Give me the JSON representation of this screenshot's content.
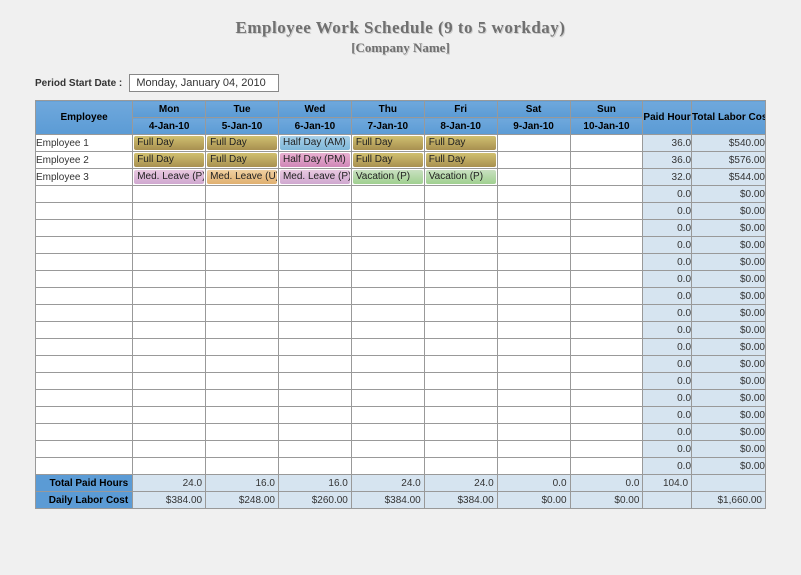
{
  "title": "Employee Work Schedule (9 to 5  workday)",
  "subtitle": "[Company Name]",
  "period_label": "Period Start Date :",
  "period_value": "Monday, January 04, 2010",
  "headers": {
    "employee": "Employee",
    "paid_hours": "Paid Hours",
    "total_cost": "Total Labor Cost",
    "days": [
      {
        "dow": "Mon",
        "date": "4-Jan-10"
      },
      {
        "dow": "Tue",
        "date": "5-Jan-10"
      },
      {
        "dow": "Wed",
        "date": "6-Jan-10"
      },
      {
        "dow": "Thu",
        "date": "7-Jan-10"
      },
      {
        "dow": "Fri",
        "date": "8-Jan-10"
      },
      {
        "dow": "Sat",
        "date": "9-Jan-10"
      },
      {
        "dow": "Sun",
        "date": "10-Jan-10"
      }
    ]
  },
  "rows": [
    {
      "name": "Employee 1",
      "cells": [
        {
          "t": "Full Day",
          "c": "full-day"
        },
        {
          "t": "Full Day",
          "c": "full-day"
        },
        {
          "t": "Half Day (AM)",
          "c": "half-am"
        },
        {
          "t": "Full Day",
          "c": "full-day"
        },
        {
          "t": "Full Day",
          "c": "full-day"
        },
        null,
        null
      ],
      "hours": "36.0",
      "cost": "$540.00"
    },
    {
      "name": "Employee 2",
      "cells": [
        {
          "t": "Full Day",
          "c": "full-day"
        },
        {
          "t": "Full Day",
          "c": "full-day",
          "dd": true
        },
        {
          "t": "Half Day (PM)",
          "c": "half-pm"
        },
        {
          "t": "Full Day",
          "c": "full-day"
        },
        {
          "t": "Full Day",
          "c": "full-day"
        },
        null,
        null
      ],
      "hours": "36.0",
      "cost": "$576.00"
    },
    {
      "name": "Employee 3",
      "cells": [
        {
          "t": "Med. Leave (P)",
          "c": "med-p"
        },
        {
          "t": "Med. Leave (U)",
          "c": "med-u"
        },
        {
          "t": "Med. Leave (P)",
          "c": "med-p"
        },
        {
          "t": "Vacation (P)",
          "c": "vac-p"
        },
        {
          "t": "Vacation (P)",
          "c": "vac-p"
        },
        null,
        null
      ],
      "hours": "32.0",
      "cost": "$544.00"
    },
    {
      "name": "",
      "cells": [
        null,
        null,
        null,
        null,
        null,
        null,
        null
      ],
      "hours": "0.0",
      "cost": "$0.00"
    },
    {
      "name": "",
      "cells": [
        null,
        null,
        null,
        null,
        null,
        null,
        null
      ],
      "hours": "0.0",
      "cost": "$0.00"
    },
    {
      "name": "",
      "cells": [
        null,
        null,
        null,
        null,
        null,
        null,
        null
      ],
      "hours": "0.0",
      "cost": "$0.00"
    },
    {
      "name": "",
      "cells": [
        null,
        null,
        null,
        null,
        null,
        null,
        null
      ],
      "hours": "0.0",
      "cost": "$0.00"
    },
    {
      "name": "",
      "cells": [
        null,
        null,
        null,
        null,
        null,
        null,
        null
      ],
      "hours": "0.0",
      "cost": "$0.00"
    },
    {
      "name": "",
      "cells": [
        null,
        null,
        null,
        null,
        null,
        null,
        null
      ],
      "hours": "0.0",
      "cost": "$0.00"
    },
    {
      "name": "",
      "cells": [
        null,
        null,
        null,
        null,
        null,
        null,
        null
      ],
      "hours": "0.0",
      "cost": "$0.00"
    },
    {
      "name": "",
      "cells": [
        null,
        null,
        null,
        null,
        null,
        null,
        null
      ],
      "hours": "0.0",
      "cost": "$0.00"
    },
    {
      "name": "",
      "cells": [
        null,
        null,
        null,
        null,
        null,
        null,
        null
      ],
      "hours": "0.0",
      "cost": "$0.00"
    },
    {
      "name": "",
      "cells": [
        null,
        null,
        null,
        null,
        null,
        null,
        null
      ],
      "hours": "0.0",
      "cost": "$0.00"
    },
    {
      "name": "",
      "cells": [
        null,
        null,
        null,
        null,
        null,
        null,
        null
      ],
      "hours": "0.0",
      "cost": "$0.00"
    },
    {
      "name": "",
      "cells": [
        null,
        null,
        null,
        null,
        null,
        null,
        null
      ],
      "hours": "0.0",
      "cost": "$0.00"
    },
    {
      "name": "",
      "cells": [
        null,
        null,
        null,
        null,
        null,
        null,
        null
      ],
      "hours": "0.0",
      "cost": "$0.00"
    },
    {
      "name": "",
      "cells": [
        null,
        null,
        null,
        null,
        null,
        null,
        null
      ],
      "hours": "0.0",
      "cost": "$0.00"
    },
    {
      "name": "",
      "cells": [
        null,
        null,
        null,
        null,
        null,
        null,
        null
      ],
      "hours": "0.0",
      "cost": "$0.00"
    },
    {
      "name": "",
      "cells": [
        null,
        null,
        null,
        null,
        null,
        null,
        null
      ],
      "hours": "0.0",
      "cost": "$0.00"
    },
    {
      "name": "",
      "cells": [
        null,
        null,
        null,
        null,
        null,
        null,
        null
      ],
      "hours": "0.0",
      "cost": "$0.00"
    }
  ],
  "totals": {
    "paid_hours_label": "Total Paid Hours",
    "daily_cost_label": "Daily Labor Cost",
    "daily_hours": [
      "24.0",
      "16.0",
      "16.0",
      "24.0",
      "24.0",
      "0.0",
      "0.0"
    ],
    "daily_cost": [
      "$384.00",
      "$248.00",
      "$260.00",
      "$384.00",
      "$384.00",
      "$0.00",
      "$0.00"
    ],
    "total_hours": "104.0",
    "grand_cost": "$1,660.00"
  },
  "chart_data": {
    "type": "table",
    "title": "Employee Work Schedule (9 to 5 workday)",
    "columns": [
      "Employee",
      "Mon 4-Jan-10",
      "Tue 5-Jan-10",
      "Wed 6-Jan-10",
      "Thu 7-Jan-10",
      "Fri 8-Jan-10",
      "Sat 9-Jan-10",
      "Sun 10-Jan-10",
      "Paid Hours",
      "Total Labor Cost"
    ],
    "rows": [
      [
        "Employee 1",
        "Full Day",
        "Full Day",
        "Half Day (AM)",
        "Full Day",
        "Full Day",
        "",
        "",
        36.0,
        540.0
      ],
      [
        "Employee 2",
        "Full Day",
        "Full Day",
        "Half Day (PM)",
        "Full Day",
        "Full Day",
        "",
        "",
        36.0,
        576.0
      ],
      [
        "Employee 3",
        "Med. Leave (P)",
        "Med. Leave (U)",
        "Med. Leave (P)",
        "Vacation (P)",
        "Vacation (P)",
        "",
        "",
        32.0,
        544.0
      ]
    ],
    "totals": {
      "Total Paid Hours": [
        24.0,
        16.0,
        16.0,
        24.0,
        24.0,
        0.0,
        0.0,
        104.0
      ],
      "Daily Labor Cost": [
        384.0,
        248.0,
        260.0,
        384.0,
        384.0,
        0.0,
        0.0,
        1660.0
      ]
    }
  }
}
